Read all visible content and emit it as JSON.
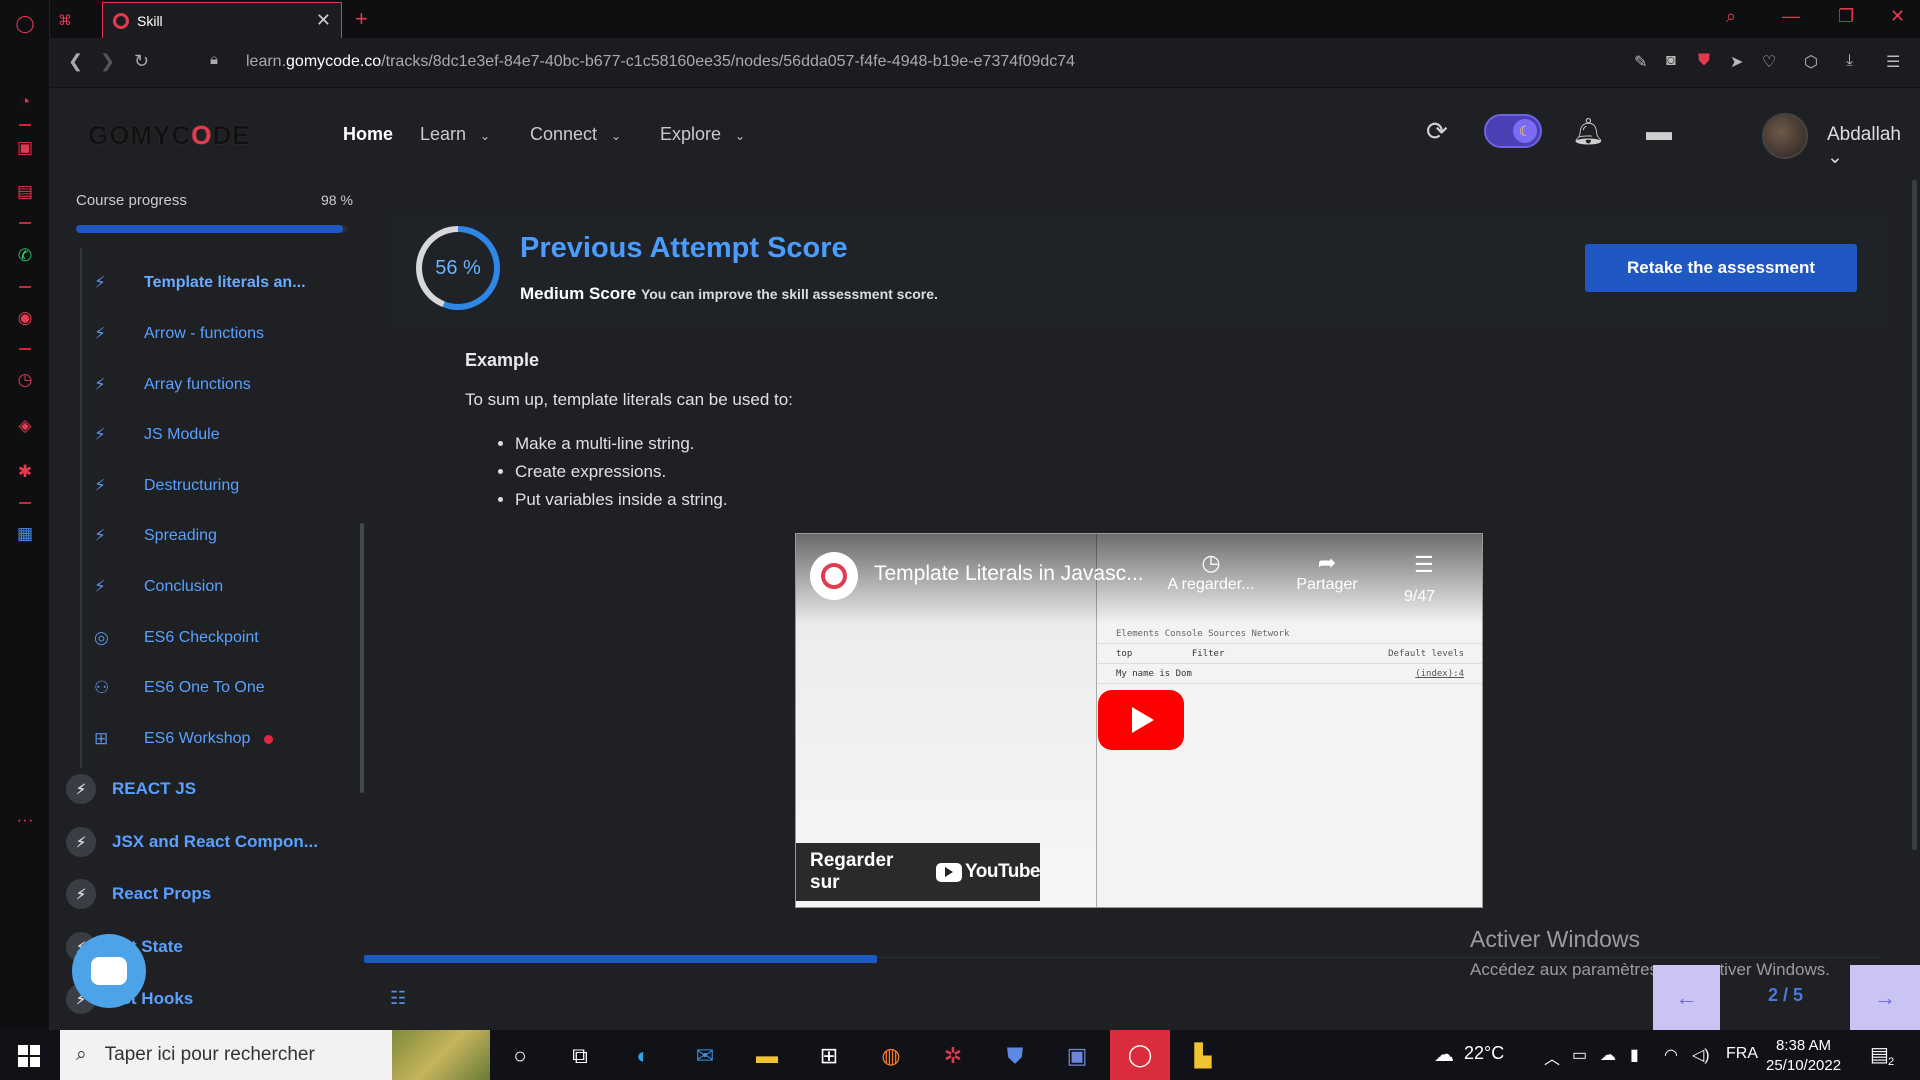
{
  "browser": {
    "tab_title": "Skill",
    "url_prefix": "learn.",
    "url_domain": "gomycode.co",
    "url_path": "/tracks/8dc1e3ef-84e7-40bc-b677-c1c58160ee35/nodes/56dda057-f4fe-4948-b19e-e7374f09dc74"
  },
  "header": {
    "logo_a": "GOMYC",
    "logo_b": "O",
    "logo_c": "DE",
    "nav": {
      "home": "Home",
      "learn": "Learn",
      "connect": "Connect",
      "explore": "Explore"
    },
    "user_name": "Abdallah"
  },
  "course": {
    "progress_label": "Course progress",
    "progress_text": "98 %",
    "progress_value": 0.98,
    "lessons": [
      {
        "label": "Template literals an...",
        "icon": "bolt-icon"
      },
      {
        "label": "Arrow - functions",
        "icon": "bolt-icon"
      },
      {
        "label": "Array functions",
        "icon": "bolt-icon"
      },
      {
        "label": "JS Module",
        "icon": "bolt-icon"
      },
      {
        "label": "Destructuring",
        "icon": "bolt-icon"
      },
      {
        "label": "Spreading",
        "icon": "bolt-icon"
      },
      {
        "label": "Conclusion",
        "icon": "bolt-icon"
      },
      {
        "label": "ES6 Checkpoint",
        "icon": "target-icon"
      },
      {
        "label": "ES6 One To One",
        "icon": "people-icon"
      },
      {
        "label": "ES6 Workshop",
        "icon": "workshop-icon"
      }
    ],
    "modules": [
      {
        "label": "REACT JS"
      },
      {
        "label": "JSX and React Compon..."
      },
      {
        "label": "React Props"
      },
      {
        "label": "act State"
      },
      {
        "label": "act Hooks"
      }
    ]
  },
  "score": {
    "percent_text": "56 %",
    "percent_value": 0.56,
    "title": "Previous Attempt Score",
    "level": "Medium Score",
    "hint": "You can improve the skill assessment score.",
    "retake_label": "Retake the assessment"
  },
  "content": {
    "example_title": "Example",
    "intro": "To sum up, template literals can be used to:",
    "items": [
      "Make a multi-line string.",
      "Create expressions.",
      "Put variables inside a string."
    ]
  },
  "video": {
    "title": "Template Literals in Javasc...",
    "watch_later": "A regarder...",
    "share": "Partager",
    "count": "9/47",
    "watch_on": "Regarder sur",
    "youtube": "YouTube",
    "devtools_top": "top",
    "devtools_filter": "Filter",
    "devtools_levels": "Default levels",
    "devtools_tabs": "Elements   Console   Sources   Network",
    "console_line": "My name is Dom",
    "console_ref": "(index):4",
    "console_prompt": ">"
  },
  "lesson_progress_value": 0.34,
  "pager": {
    "prev": "←",
    "count": "2 / 5",
    "next": "→"
  },
  "watermark": {
    "line1": "Activer Windows",
    "line2": "Accédez aux paramètres pour activer Windows."
  },
  "taskbar": {
    "search_placeholder": "Taper ici pour rechercher",
    "weather": "22°C",
    "lang": "FRA",
    "time": "8:38 AM",
    "date": "25/10/2022",
    "notif_count": "2"
  },
  "colors": {
    "accent": "#1f57c3",
    "link": "#5aa0ff",
    "opera_red": "#e43a4f"
  }
}
